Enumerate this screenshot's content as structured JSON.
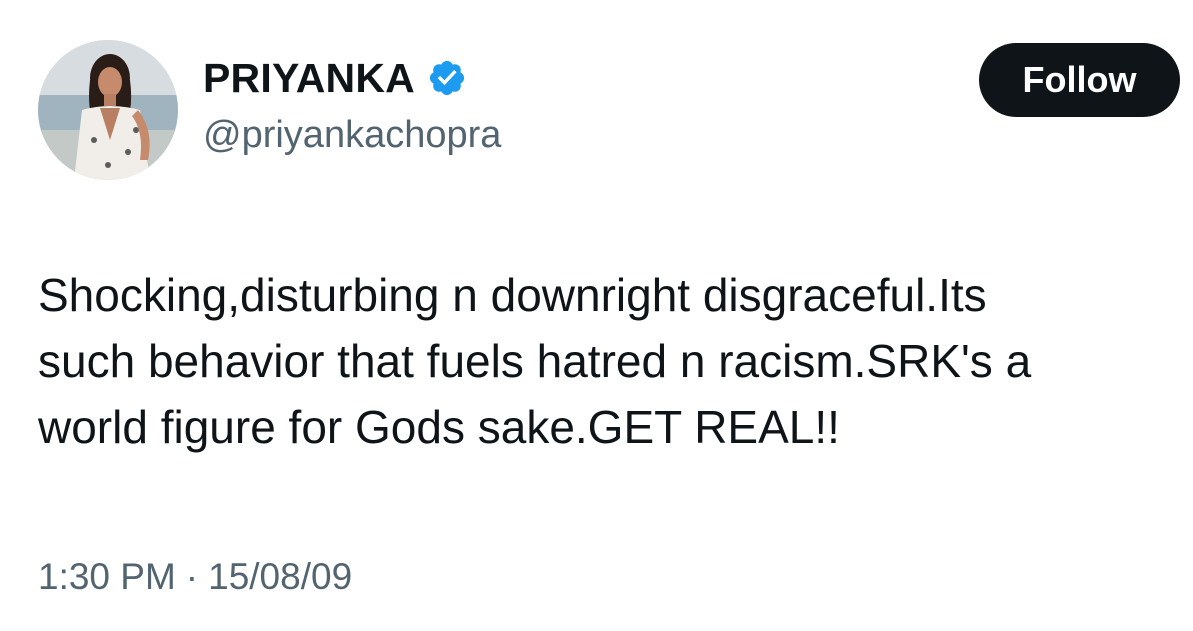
{
  "user": {
    "display_name": "PRIYANKA",
    "handle": "@priyankachopra",
    "verified": true,
    "verified_color": "#1d9bf0",
    "avatar_icon": "profile-photo"
  },
  "actions": {
    "follow_label": "Follow"
  },
  "tweet": {
    "lines": [
      "Shocking,disturbing n downright disgraceful.Its",
      "such behavior that fuels hatred n racism.SRK's a",
      "world figure for Gods sake.GET REAL!!"
    ],
    "time": "1:30 PM",
    "separator": "·",
    "date": "15/08/09"
  },
  "colors": {
    "text_primary": "#0f1419",
    "text_secondary": "#536471",
    "button_bg": "#0f1419",
    "button_text": "#ffffff"
  }
}
